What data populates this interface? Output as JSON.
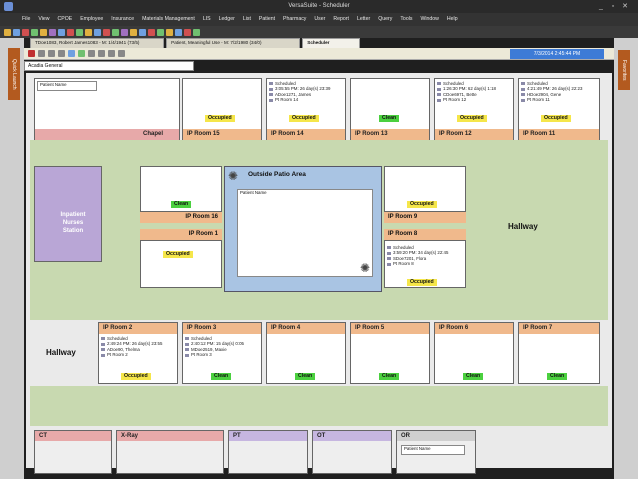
{
  "window": {
    "title": "VersaSuite - Scheduler",
    "min": "_",
    "max": "▫",
    "close": "✕"
  },
  "menu": [
    "File",
    "View",
    "CPOE",
    "Employee",
    "Insurance",
    "Materials Management",
    "LIS",
    "Ledger",
    "List",
    "Patient",
    "Pharmacy",
    "User",
    "Report",
    "Letter",
    "Query",
    "Tools",
    "Window",
    "Help"
  ],
  "tabs": [
    {
      "label": "TDoe1083, Robert James1083 - M: 1/4/1941 (73/5)"
    },
    {
      "label": "Patient, Meaningful Use - M: 7/2/1980 (34/0)"
    },
    {
      "label": "Scheduler"
    }
  ],
  "side_tab": "Quick Launch",
  "right_tab": "Favorites",
  "datetime": "7/3/2014 2:45:44 PM",
  "unit": "Acadia General",
  "labels": {
    "patio": "Outside Patio Area",
    "nurses": "Inpatient Nurses Station",
    "hallway_right": "Hallway",
    "hallway_left": "Hallway",
    "patient_name": "Patient Name"
  },
  "top_rooms": [
    {
      "name": "Chapel",
      "status": "",
      "info": []
    },
    {
      "name": "IP Room 15",
      "status": "Occupied",
      "info": []
    },
    {
      "name": "IP Room 14",
      "status": "Occupied",
      "info": [
        "Scheduled",
        "3:05:55 PM: 26 day(s) 23:39",
        "ADoe1271, James",
        "Pt Room 14"
      ]
    },
    {
      "name": "IP Room 13",
      "status": "Clean",
      "info": []
    },
    {
      "name": "IP Room 12",
      "status": "Occupied",
      "info": [
        "Scheduled",
        "1:26:30 PM: 62 day(s) 1:18",
        "CDoe6971, Bette",
        "Pt Room 12"
      ]
    },
    {
      "name": "IP Room 11",
      "status": "Occupied",
      "info": [
        "Scheduled",
        "4:21:49 PM: 26 day(s) 22:23",
        "HDoe2904, Gene",
        "Pt Room 11"
      ]
    }
  ],
  "mid_rooms": {
    "r16": {
      "name": "IP Room 16",
      "status": "Clean"
    },
    "r1": {
      "name": "IP Room 1",
      "status": "Occupied"
    },
    "r9": {
      "name": "IP Room 9",
      "status": "Occupied"
    },
    "r8": {
      "name": "IP Room 8",
      "status": "Occupied",
      "info": [
        "Scheduled",
        "3:59:20 PM: 34 day(s) 22:45",
        "SDoe7201, Flora",
        "Pt Room 8"
      ]
    }
  },
  "lower_rooms": [
    {
      "name": "IP Room 2",
      "status": "Occupied",
      "info": [
        "Scheduled",
        "2:49:24 PM: 26 day(s) 23:55",
        "ADoe90, Thelma",
        "Pt Room 2"
      ]
    },
    {
      "name": "IP Room 3",
      "status": "Clean",
      "info": [
        "Scheduled",
        "2:40:12 PM: 15 day(s) 0:05",
        "MDoe2519, Maxie",
        "Pt Room 3"
      ]
    },
    {
      "name": "IP Room 4",
      "status": "Clean",
      "info": []
    },
    {
      "name": "IP Room 5",
      "status": "Clean",
      "info": []
    },
    {
      "name": "IP Room 6",
      "status": "Clean",
      "info": []
    },
    {
      "name": "IP Room 7",
      "status": "Clean",
      "info": []
    }
  ],
  "bottom_rooms": [
    {
      "name": "CT",
      "color": "#e7a9a9"
    },
    {
      "name": "X-Ray",
      "color": "#e7a9a9"
    },
    {
      "name": "PT",
      "color": "#c6b6e0"
    },
    {
      "name": "OT",
      "color": "#c6b6e0"
    },
    {
      "name": "OR",
      "color": "#d0d0d0"
    }
  ],
  "colors": {
    "occupied": "#f5e64a",
    "clean": "#4bd03f",
    "room_header": "#f0b98c",
    "corridor": "#c8d9b0",
    "accent": "#b35a1f"
  }
}
